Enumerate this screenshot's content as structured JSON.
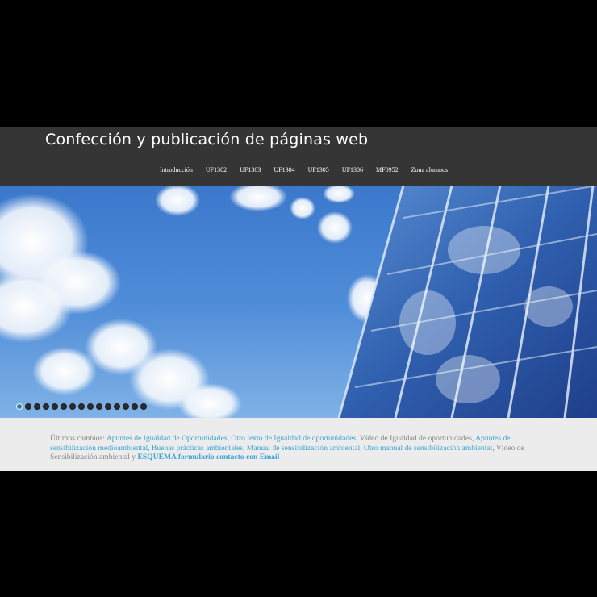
{
  "header": {
    "title": "Confección y publicación de páginas web",
    "nav": [
      "Introducción",
      "UF1302",
      "UF1303",
      "UF1304",
      "UF1305",
      "UF1306",
      "MF0952",
      "Zona alumnos"
    ]
  },
  "slider": {
    "dot_count": 15,
    "active_index": 0
  },
  "changes": {
    "prefix": "Últimos cambios: ",
    "link1": "Apuntes de Igualdad de Oportunidades",
    "sep1": ", ",
    "link2": "Otro texto de Igualdad de oportunidades",
    "text1": ", Vídeo de Igualdad de oportunidades, ",
    "link3": "Apuntes de sensibilización medioambiental",
    "sep2": ", ",
    "link4": "Buenas prácticas ambientales",
    "sep3": ", ",
    "link5": "Manual de sensibilización ambiental",
    "sep4": ", ",
    "link6": "Otro manual de sensibilización ambiental",
    "text2": ", Vídeo de Sensibilización ambiental y ",
    "link7": "ESQUEMA formulario contacto con Email"
  },
  "colors": {
    "header_bg": "#353535",
    "link": "#3aa3d9",
    "text_muted": "#858585",
    "footer_bg": "#ececec"
  }
}
